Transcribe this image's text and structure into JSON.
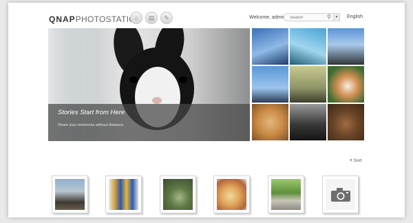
{
  "header": {
    "logo_brand": "QNAP",
    "logo_product": "PHOTOSTATION",
    "welcome_text": "Welcome, admin",
    "search_placeholder": "Search",
    "language": "English",
    "nav_icons": [
      "home-icon",
      "album-icon",
      "settings-icon"
    ]
  },
  "hero": {
    "title": "Stories Start from Here",
    "subtitle": "Share your memories without distance."
  },
  "sort": {
    "label": "Sort"
  },
  "colors": {
    "caption_overlay": "#464646",
    "page_background": "#e9e9e9",
    "card_background": "#ffffff"
  },
  "mosaic_count": 9,
  "thumbnails": [
    "trees-photo",
    "flags-photo",
    "garden-photo",
    "food-photo",
    "landscape-photo",
    "camera-placeholder-icon"
  ]
}
